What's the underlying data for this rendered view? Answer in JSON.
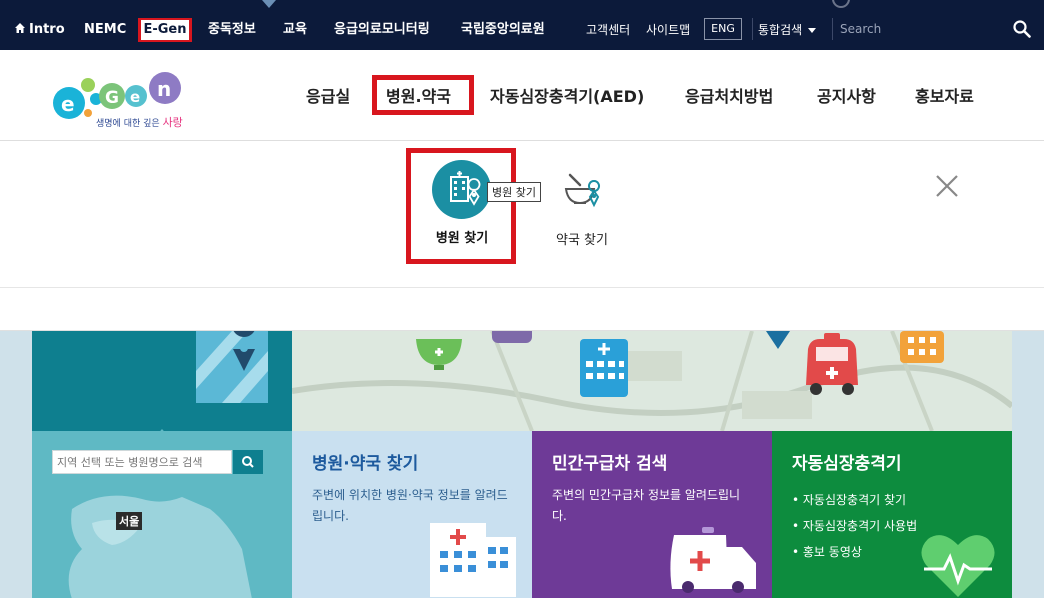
{
  "topbar": {
    "intro": "Intro",
    "nemc": "NEMC",
    "egen": "E-Gen",
    "menu": [
      "중독정보",
      "교육",
      "응급의료모니터링",
      "국립중앙의료원"
    ],
    "util": [
      "고객센터",
      "사이트맵"
    ],
    "eng": "ENG",
    "integrated_search": "통합검색",
    "search_placeholder": "Search"
  },
  "logo": {
    "tagline_small": "생명에 대한 깊은",
    "tagline_big": "사랑"
  },
  "nav": {
    "items": [
      "응급실",
      "병원.약국",
      "자동심장충격기(AED)",
      "응급처치방법",
      "공지사항",
      "홍보자료"
    ]
  },
  "submenu": {
    "hospital": "병원 찾기",
    "tooltip": "병원 찾기",
    "pharmacy": "약국 찾기"
  },
  "cards": {
    "region_search_placeholder": "지역 선택 또는 병원명으로 검색",
    "seoul": "서울",
    "hospital_pharmacy": {
      "title": "병원·약국 찾기",
      "desc": "주변에 위치한 병원·약국 정보를 알려드립니다."
    },
    "ambulance": {
      "title": "민간구급차 검색",
      "desc": "주변의 민간구급차 정보를 알려드립니다."
    },
    "aed": {
      "title": "자동심장충격기",
      "items": [
        "• 자동심장충격기 찾기",
        "• 자동심장충격기 사용법",
        "• 홍보 동영상"
      ]
    }
  },
  "colors": {
    "topbar_bg": "#0c1a3a",
    "highlight_red": "#d8161e",
    "teal": "#1b8fa3",
    "card_light_blue": "#c9e0f0",
    "card_purple": "#6e3a97",
    "card_green": "#0d8c3e"
  }
}
